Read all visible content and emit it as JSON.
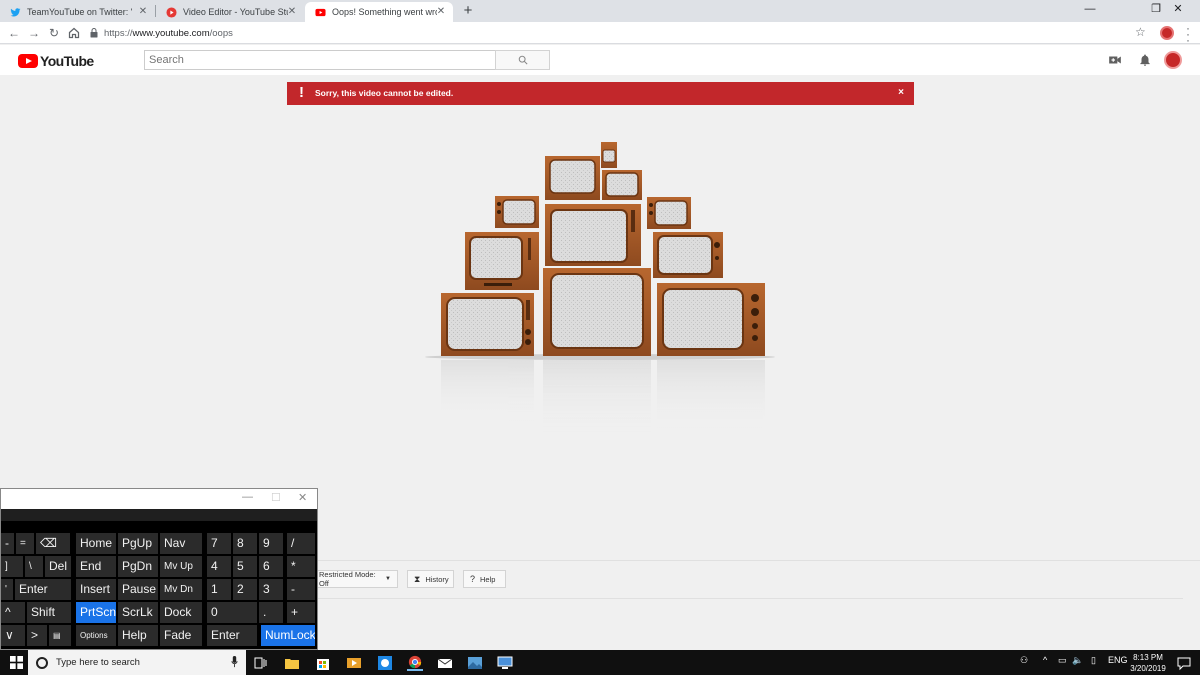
{
  "browser": {
    "tabs": [
      {
        "title": "TeamYouTube on Twitter: \"We'd",
        "icon": "twitter-icon",
        "active": false
      },
      {
        "title": "Video Editor - YouTube Studio",
        "icon": "youtube-icon",
        "active": false
      },
      {
        "title": "Oops! Something went wrong.",
        "icon": "youtube-icon",
        "active": true
      }
    ],
    "new_tab": "+",
    "url_scheme": "https://",
    "url_host": "www.youtube.com",
    "url_path": "/oops"
  },
  "youtube": {
    "logo_text": "YouTube",
    "search_placeholder": "Search"
  },
  "error_banner": {
    "message": "Sorry, this video cannot be edited.",
    "close": "×"
  },
  "footer": {
    "restricted_mode": "Restricted Mode: Off",
    "history": "History",
    "help": "Help"
  },
  "osk": {
    "keys": [
      {
        "label": "-"
      },
      {
        "label": "="
      },
      {
        "label": "⌫"
      },
      {
        "label": "Home"
      },
      {
        "label": "PgUp"
      },
      {
        "label": "Nav"
      },
      {
        "label": "7"
      },
      {
        "label": "8"
      },
      {
        "label": "9"
      },
      {
        "label": "/"
      },
      {
        "label": "]"
      },
      {
        "label": "\\"
      },
      {
        "label": "Del"
      },
      {
        "label": "End"
      },
      {
        "label": "PgDn"
      },
      {
        "label": "Mv Up"
      },
      {
        "label": "4"
      },
      {
        "label": "5"
      },
      {
        "label": "6"
      },
      {
        "label": "*"
      },
      {
        "label": "'"
      },
      {
        "label": "Enter"
      },
      {
        "label": "Insert"
      },
      {
        "label": "Pause"
      },
      {
        "label": "Mv Dn"
      },
      {
        "label": "1"
      },
      {
        "label": "2"
      },
      {
        "label": "3"
      },
      {
        "label": "-"
      },
      {
        "label": "^"
      },
      {
        "label": "Shift"
      },
      {
        "label": "PrtScn"
      },
      {
        "label": "ScrLk"
      },
      {
        "label": "Dock"
      },
      {
        "label": "0"
      },
      {
        "label": "."
      },
      {
        "label": "+"
      },
      {
        "label": "∨"
      },
      {
        "label": ">"
      },
      {
        "label": "▤"
      },
      {
        "label": "Options"
      },
      {
        "label": "Help"
      },
      {
        "label": "Fade"
      },
      {
        "label": "Enter"
      },
      {
        "label": "NumLock"
      }
    ]
  },
  "taskbar": {
    "search_placeholder": "Type here to search",
    "language": "ENG",
    "time": "8:13 PM",
    "date": "3/20/2019"
  }
}
